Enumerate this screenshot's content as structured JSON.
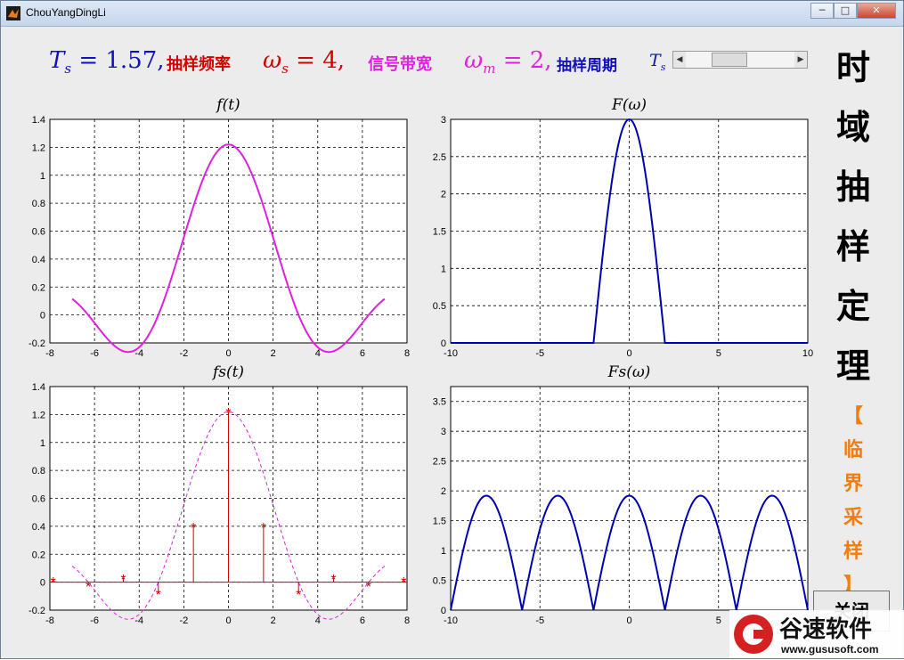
{
  "window": {
    "title": "ChouYangDingLi",
    "btn_min": "─",
    "btn_max": "□",
    "btn_close": "✕"
  },
  "header": {
    "ts_label": "T",
    "ts_sub": "s",
    "ts_eq": "= 1.57,",
    "sample_freq_label": "抽样频率",
    "ws_symbol": "ω",
    "ws_sub": "s",
    "ws_eq": "= 4,",
    "bandwidth_label": "信号带宽",
    "wm_symbol": "ω",
    "wm_sub": "m",
    "wm_eq": "= 2,",
    "period_label": "抽样周期",
    "period_symbol": "T",
    "period_sub": "s"
  },
  "slider": {
    "value_fraction": 0.35,
    "left_arrow": "◀",
    "right_arrow": "▶"
  },
  "side_title": [
    "时",
    "域",
    "抽",
    "样",
    "定",
    "理"
  ],
  "side_subtitle": [
    "【",
    "临",
    "界",
    "采",
    "样",
    "】"
  ],
  "close_button": "关闭",
  "watermark": {
    "brand": "谷速软件",
    "url": "www.gususoft.com"
  },
  "colors": {
    "magenta": "#e020e0",
    "blue": "#1010c0",
    "red": "#d40000",
    "orange": "#ef7d10",
    "plot_blue": "#0000b0",
    "stem_red": "#d40000"
  },
  "chart_data": [
    {
      "type": "line",
      "title": "f(t)",
      "xlim": [
        -8,
        8
      ],
      "ylim": [
        -0.2,
        1.4
      ],
      "xticks": [
        "-8",
        "-6",
        "-4",
        "-2",
        "0",
        "2",
        "4",
        "6",
        "8"
      ],
      "yticks": [
        "-0.2",
        "0",
        "0.2",
        "0.4",
        "0.6",
        "0.8",
        "1",
        "1.2",
        "1.4"
      ],
      "grid": true,
      "series": [
        {
          "color": "#e020e0",
          "kind": "sinc",
          "amplitude": 1.22,
          "xrange": [
            -7,
            7
          ]
        }
      ]
    },
    {
      "type": "line",
      "title": "F(ω)",
      "xlim": [
        -10,
        10
      ],
      "ylim": [
        0,
        3
      ],
      "xticks": [
        "-10",
        "-5",
        "0",
        "5",
        "10"
      ],
      "yticks": [
        "0",
        "0.5",
        "1",
        "1.5",
        "2",
        "2.5",
        "3"
      ],
      "grid": true,
      "series": [
        {
          "color": "#0000b0",
          "kind": "cos-bump",
          "peak": 3,
          "half_width": 2
        }
      ]
    },
    {
      "type": "scatter",
      "title": "fs(t)",
      "xlim": [
        -8,
        8
      ],
      "ylim": [
        -0.2,
        1.4
      ],
      "xticks": [
        "-8",
        "-6",
        "-4",
        "-2",
        "0",
        "2",
        "4",
        "6",
        "8"
      ],
      "yticks": [
        "-0.2",
        "0",
        "0.2",
        "0.4",
        "0.6",
        "0.8",
        "1",
        "1.2",
        "1.4"
      ],
      "grid": true,
      "samples_x": [
        -7.85,
        -6.28,
        -4.71,
        -3.14,
        -1.57,
        0,
        1.57,
        3.14,
        4.71,
        6.28,
        7.85
      ],
      "samples_y": [
        0.01,
        -0.02,
        0.03,
        -0.08,
        0.4,
        1.22,
        0.4,
        -0.08,
        0.03,
        -0.02,
        0.01
      ],
      "series": [
        {
          "color": "#d40000",
          "kind": "stem"
        },
        {
          "color": "#e020e0",
          "kind": "dashed-envelope",
          "amplitude": 1.22
        }
      ]
    },
    {
      "type": "line",
      "title": "Fs(ω)",
      "xlim": [
        -10,
        10
      ],
      "ylim": [
        0,
        3.75
      ],
      "xticks": [
        "-10",
        "-5",
        "0",
        "5",
        "10"
      ],
      "yticks": [
        "0",
        "0.5",
        "1",
        "1.5",
        "2",
        "2.5",
        "3",
        "3.5"
      ],
      "grid": true,
      "centers": [
        -8,
        -4,
        0,
        4,
        8
      ],
      "series": [
        {
          "color": "#0000b0",
          "kind": "periodic-bumps",
          "peak": 1.92,
          "half_width": 2
        }
      ]
    }
  ]
}
